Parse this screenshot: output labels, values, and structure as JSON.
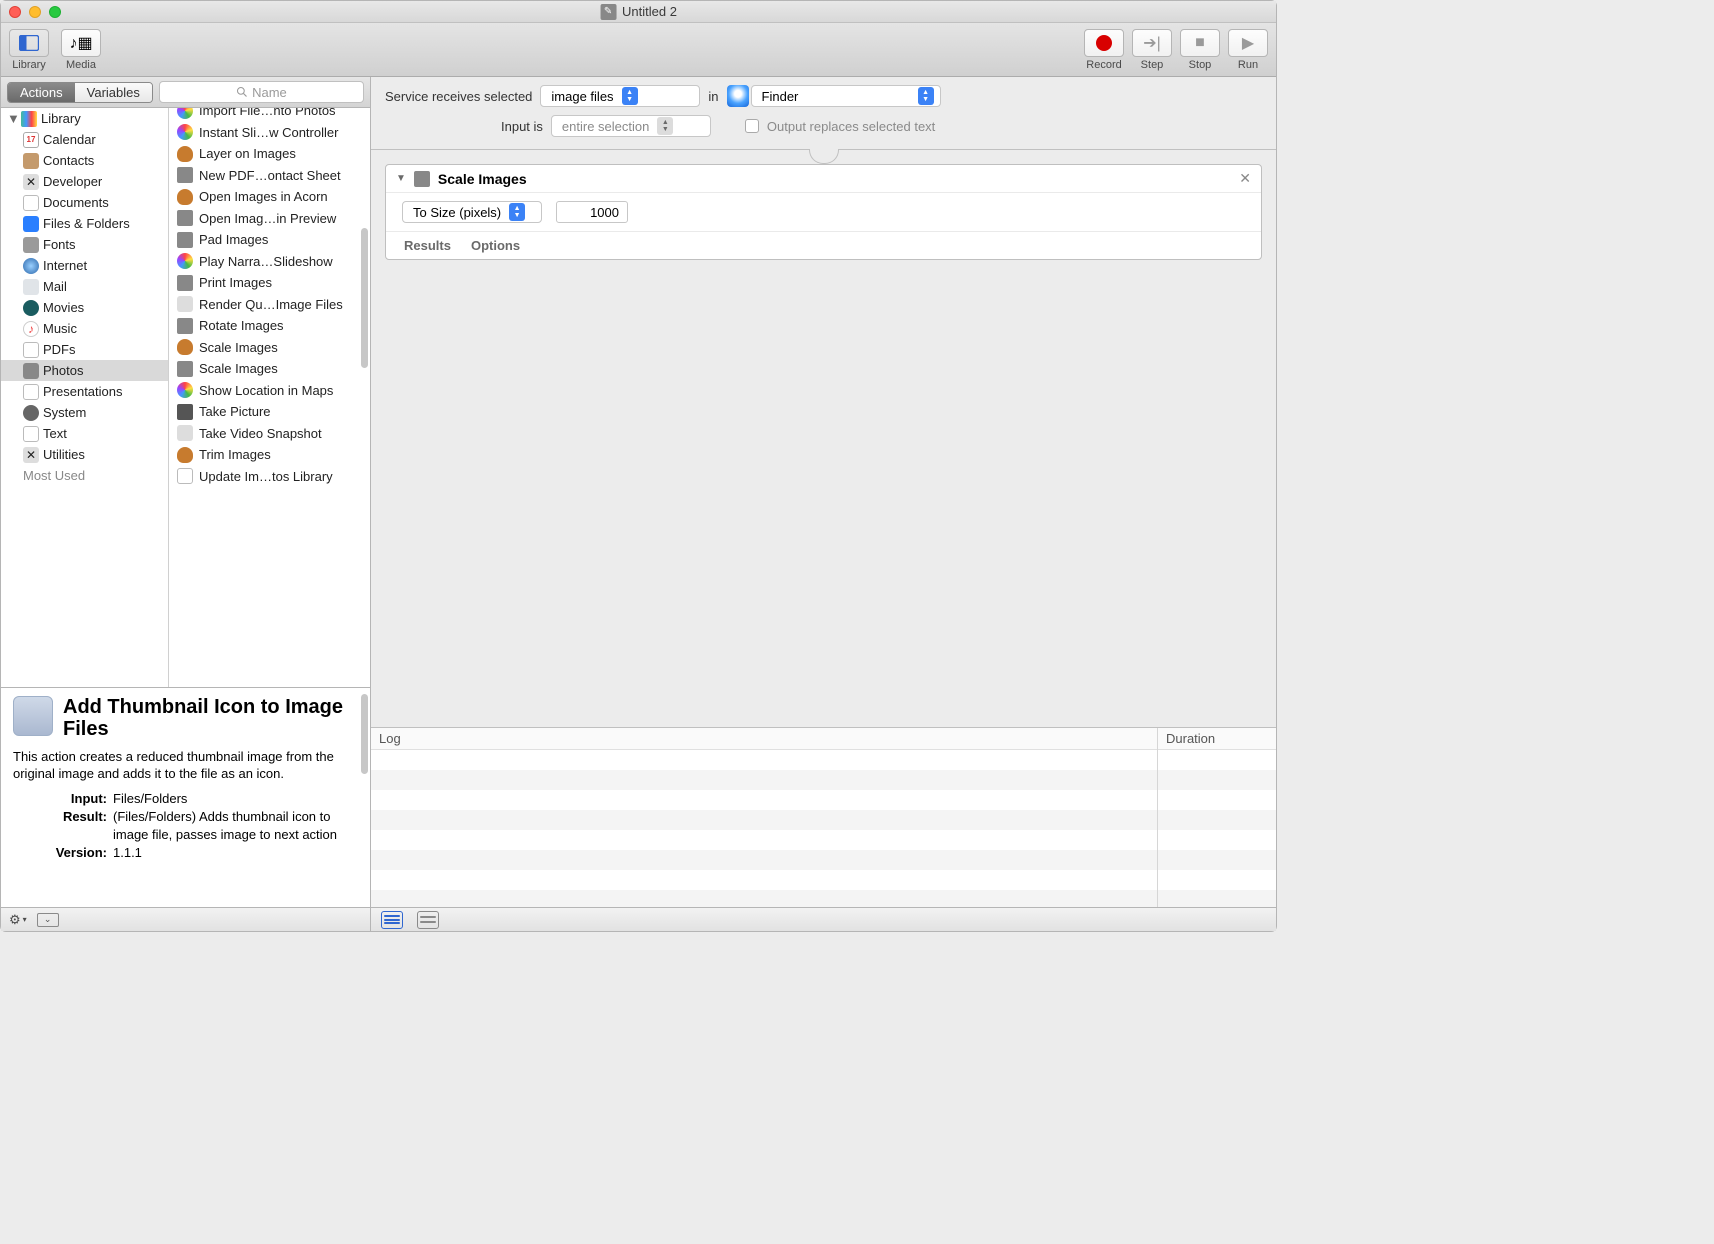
{
  "window": {
    "title": "Untitled 2"
  },
  "toolbar": {
    "library_label": "Library",
    "media_label": "Media",
    "record_label": "Record",
    "step_label": "Step",
    "stop_label": "Stop",
    "run_label": "Run"
  },
  "segmented": {
    "actions": "Actions",
    "variables": "Variables"
  },
  "search": {
    "placeholder": "Name"
  },
  "library": {
    "header": "Library",
    "items": [
      {
        "label": "Calendar",
        "icon": "calendar"
      },
      {
        "label": "Contacts",
        "icon": "contacts"
      },
      {
        "label": "Developer",
        "icon": "developer"
      },
      {
        "label": "Documents",
        "icon": "documents"
      },
      {
        "label": "Files & Folders",
        "icon": "finder"
      },
      {
        "label": "Fonts",
        "icon": "fonts"
      },
      {
        "label": "Internet",
        "icon": "internet"
      },
      {
        "label": "Mail",
        "icon": "mail"
      },
      {
        "label": "Movies",
        "icon": "movies"
      },
      {
        "label": "Music",
        "icon": "music"
      },
      {
        "label": "PDFs",
        "icon": "pdf"
      },
      {
        "label": "Photos",
        "icon": "photos",
        "selected": true
      },
      {
        "label": "Presentations",
        "icon": "presentations"
      },
      {
        "label": "System",
        "icon": "system"
      },
      {
        "label": "Text",
        "icon": "text"
      },
      {
        "label": "Utilities",
        "icon": "utilities"
      }
    ],
    "cutoff": "Most Used"
  },
  "actions_list": [
    {
      "label": "Import File…nto Photos",
      "icon": "colorwheel"
    },
    {
      "label": "Instant Sli…w Controller",
      "icon": "colorwheel"
    },
    {
      "label": "Layer on Images",
      "icon": "acorn"
    },
    {
      "label": "New PDF…ontact Sheet",
      "icon": "preview"
    },
    {
      "label": "Open Images in Acorn",
      "icon": "acorn"
    },
    {
      "label": "Open Imag…in Preview",
      "icon": "preview"
    },
    {
      "label": "Pad Images",
      "icon": "preview"
    },
    {
      "label": "Play Narra…Slideshow",
      "icon": "colorwheel"
    },
    {
      "label": "Print Images",
      "icon": "preview"
    },
    {
      "label": "Render Qu…Image Files",
      "icon": "tools"
    },
    {
      "label": "Rotate Images",
      "icon": "preview"
    },
    {
      "label": "Scale Images",
      "icon": "acorn"
    },
    {
      "label": "Scale Images",
      "icon": "preview"
    },
    {
      "label": "Show Location in Maps",
      "icon": "colorwheel"
    },
    {
      "label": "Take Picture",
      "icon": "camera"
    },
    {
      "label": "Take Video Snapshot",
      "icon": "tools"
    },
    {
      "label": "Trim Images",
      "icon": "acorn"
    },
    {
      "label": "Update Im…tos Library",
      "icon": "keynote"
    }
  ],
  "description": {
    "title": "Add Thumbnail Icon to Image Files",
    "body": "This action creates a reduced thumbnail image from the original image and adds it to the file as an icon.",
    "input_label": "Input:",
    "input_value": "Files/Folders",
    "result_label": "Result:",
    "result_value": "(Files/Folders) Adds thumbnail icon to image file, passes image to next action",
    "version_label": "Version:",
    "version_value": "1.1.1"
  },
  "service": {
    "receives_label": "Service receives selected",
    "receives_value": "image files",
    "in_label": "in",
    "app_value": "Finder",
    "input_is_label": "Input is",
    "input_is_value": "entire selection",
    "output_checkbox_label": "Output replaces selected text"
  },
  "workflow_action": {
    "title": "Scale Images",
    "mode": "To Size (pixels)",
    "value": "1000",
    "results_tab": "Results",
    "options_tab": "Options"
  },
  "log": {
    "log_header": "Log",
    "duration_header": "Duration"
  }
}
